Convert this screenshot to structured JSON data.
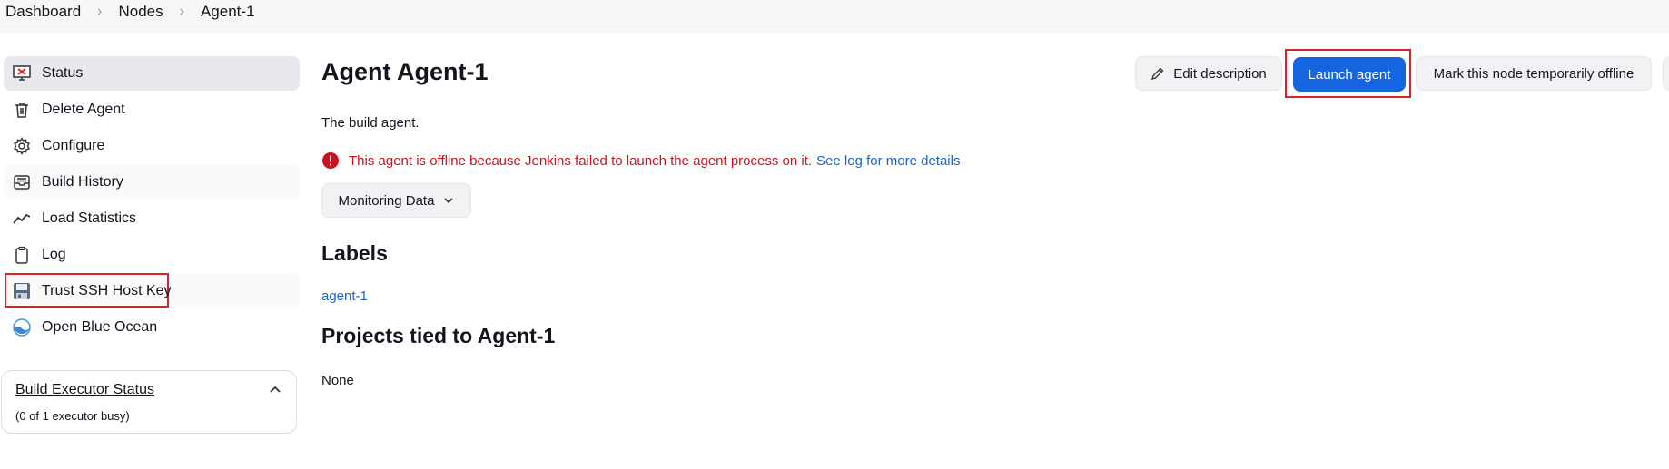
{
  "breadcrumb": [
    "Dashboard",
    "Nodes",
    "Agent-1"
  ],
  "sidebar": {
    "items": [
      {
        "label": "Status",
        "icon": "monitor-offline-icon"
      },
      {
        "label": "Delete Agent",
        "icon": "trash-icon"
      },
      {
        "label": "Configure",
        "icon": "gear-icon"
      },
      {
        "label": "Build History",
        "icon": "inbox-icon"
      },
      {
        "label": "Load Statistics",
        "icon": "trend-line-icon"
      },
      {
        "label": "Log",
        "icon": "clipboard-icon"
      },
      {
        "label": "Trust SSH Host Key",
        "icon": "floppy-disk-icon"
      },
      {
        "label": "Open Blue Ocean",
        "icon": "blue-ocean-icon"
      }
    ]
  },
  "executor": {
    "title": "Build Executor Status",
    "subtitle": "(0 of 1 executor busy)"
  },
  "main": {
    "title": "Agent Agent-1",
    "description": "The build agent.",
    "alert_text": "This agent is offline because Jenkins failed to launch the agent process on it.",
    "alert_link": "See log for more details",
    "monitoring_label": "Monitoring Data",
    "labels_heading": "Labels",
    "label_value": "agent-1",
    "projects_heading": "Projects tied to Agent-1",
    "projects_value": "None"
  },
  "actions": {
    "edit_label": "Edit description",
    "launch_label": "Launch agent",
    "offline_label": "Mark this node temporarily offline"
  },
  "colors": {
    "primary": "#1565e0",
    "error": "#d0101c",
    "link": "#1d63c5",
    "highlight": "#d9222a"
  }
}
